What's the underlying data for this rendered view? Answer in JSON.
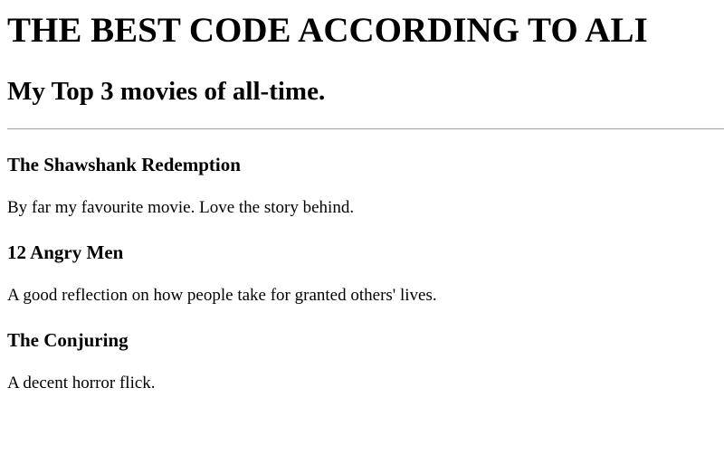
{
  "page": {
    "heading": "THE BEST CODE ACCORDING TO ALI",
    "subheading": "My Top 3 movies of all-time."
  },
  "movies": [
    {
      "title": "The Shawshank Redemption",
      "description": "By far my favourite movie. Love the story behind."
    },
    {
      "title": "12 Angry Men",
      "description": "A good reflection on how people take for granted others' lives."
    },
    {
      "title": "The Conjuring",
      "description": "A decent horror flick."
    }
  ]
}
